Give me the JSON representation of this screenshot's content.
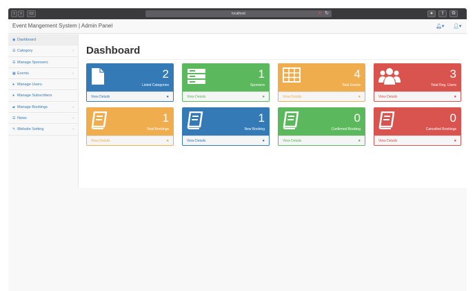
{
  "browser": {
    "url": "localhost",
    "back_icon": "chevron-left-icon",
    "forward_icon": "chevron-right-icon",
    "sidebar_toggle_icon": "sidebar-icon",
    "reload_icon": "reload-icon",
    "info_icon": "info-icon",
    "share_icon": "share-icon",
    "tabs_icon": "tabs-icon"
  },
  "header": {
    "brand": "Event Mangement System | Admin Panel",
    "alerts_icon": "bell-icon",
    "user_icon": "user-icon"
  },
  "sidebar": {
    "items": [
      {
        "label": "Dashboard",
        "icon": "dashboard-icon",
        "active": true,
        "arrow": false
      },
      {
        "label": "Category",
        "icon": "category-icon",
        "active": false,
        "arrow": true
      },
      {
        "label": "Manage Sponsers",
        "icon": "sponsors-icon",
        "active": false,
        "arrow": false
      },
      {
        "label": "Events",
        "icon": "events-icon",
        "active": false,
        "arrow": true
      },
      {
        "label": "Manage Users",
        "icon": "users-icon",
        "active": false,
        "arrow": false
      },
      {
        "label": "Manage Subscribers",
        "icon": "subscribers-icon",
        "active": false,
        "arrow": false
      },
      {
        "label": "Manage Bookings",
        "icon": "bookings-icon",
        "active": false,
        "arrow": true
      },
      {
        "label": "News",
        "icon": "news-icon",
        "active": false,
        "arrow": true
      },
      {
        "label": "Website Setting",
        "icon": "wrench-icon",
        "active": false,
        "arrow": true
      }
    ]
  },
  "main": {
    "title": "Dashboard",
    "cards": [
      {
        "value": "2",
        "label": "Listed Categories",
        "link": "View Details",
        "color": "#337ab7",
        "icon": "document-icon"
      },
      {
        "value": "1",
        "label": "Sponsers",
        "link": "View Details",
        "color": "#5cb85c",
        "icon": "server-icon"
      },
      {
        "value": "4",
        "label": "Total Events",
        "link": "View Details",
        "color": "#f0ad4e",
        "icon": "grid-icon"
      },
      {
        "value": "3",
        "label": "Total Reg. Users",
        "link": "View Details",
        "color": "#d9534f",
        "icon": "users-group-icon"
      },
      {
        "value": "1",
        "label": "Total Bookings",
        "link": "View Details",
        "color": "#f0ad4e",
        "icon": "book-icon"
      },
      {
        "value": "1",
        "label": "New Booking",
        "link": "View Details",
        "color": "#337ab7",
        "icon": "book-icon"
      },
      {
        "value": "0",
        "label": "Confirmed Booking",
        "link": "View Details",
        "color": "#5cb85c",
        "icon": "book-icon"
      },
      {
        "value": "0",
        "label": "Cancelled Bookings",
        "link": "View Details",
        "color": "#d9534f",
        "icon": "book-icon"
      }
    ]
  }
}
